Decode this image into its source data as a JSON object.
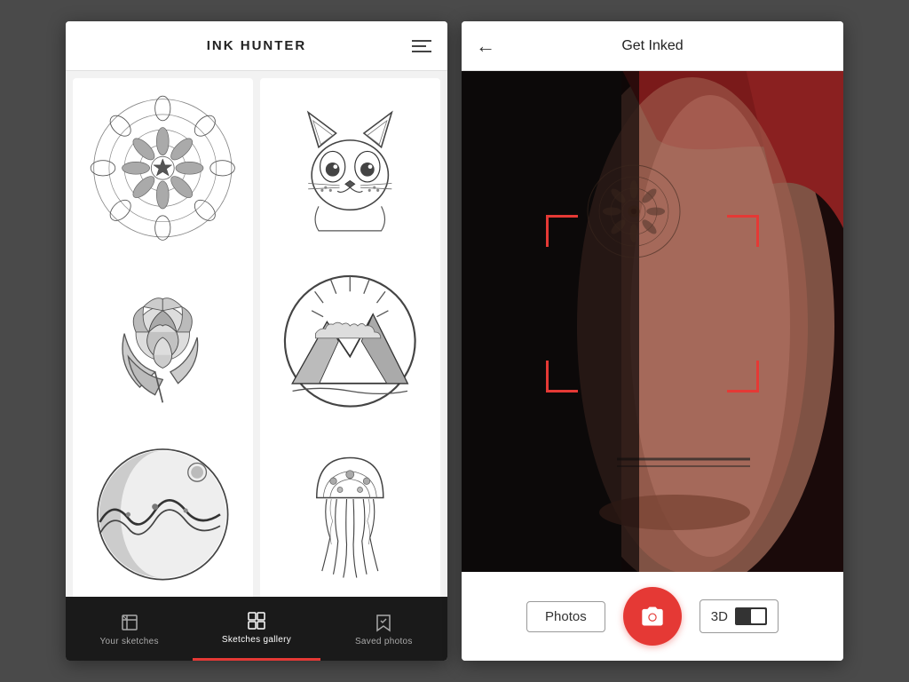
{
  "app": {
    "title": "INK HUNTER",
    "background_color": "#4a4a4a"
  },
  "left_phone": {
    "header": {
      "title": "INK HUNTER",
      "menu_icon": "hamburger-icon"
    },
    "tab_bar": {
      "tabs": [
        {
          "id": "your-sketches",
          "label": "Your sketches",
          "icon": "sketch-icon",
          "active": false
        },
        {
          "id": "sketches-gallery",
          "label": "Sketches gallery",
          "icon": "grid-icon",
          "active": true
        },
        {
          "id": "saved-photos",
          "label": "Saved photos",
          "icon": "bookmark-icon",
          "active": false
        }
      ]
    }
  },
  "right_phone": {
    "header": {
      "title": "Get Inked",
      "back_label": "←"
    },
    "controls": {
      "photos_btn": "Photos",
      "three_d_btn": "3D"
    }
  }
}
